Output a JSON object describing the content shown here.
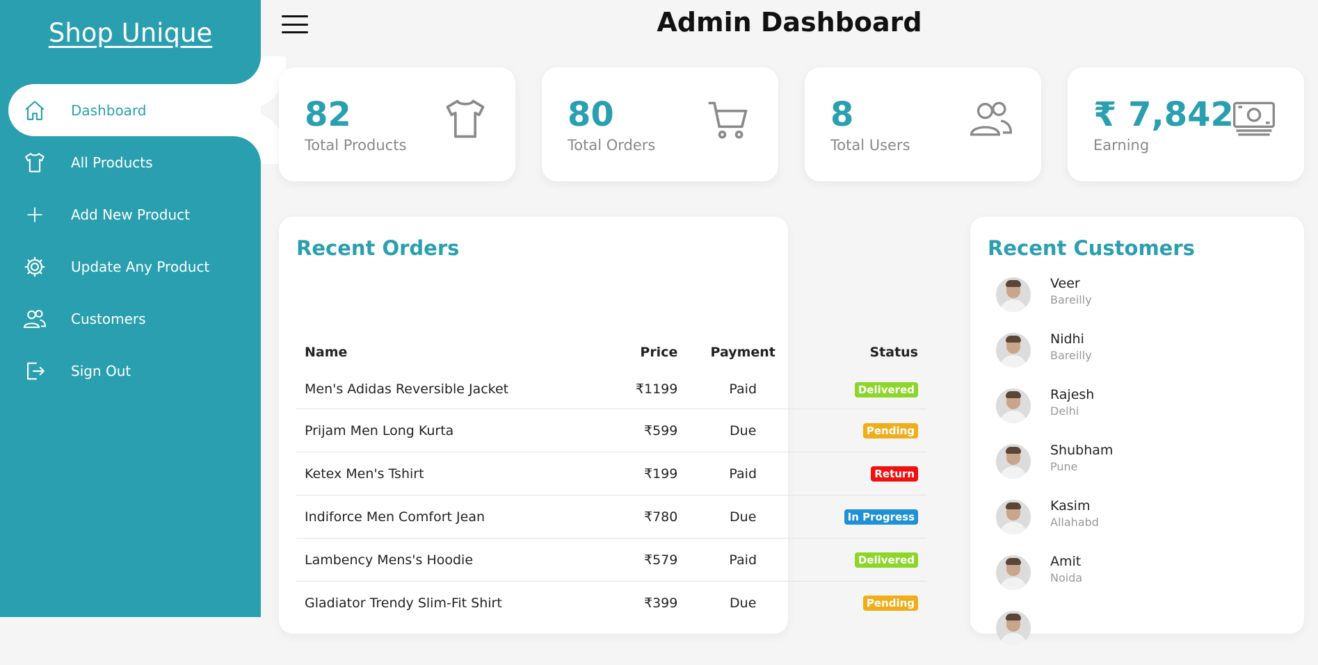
{
  "brand": "Shop Unique",
  "nav": [
    {
      "label": "Dashboard",
      "icon": "home-icon"
    },
    {
      "label": "All Products",
      "icon": "tshirt-icon"
    },
    {
      "label": "Add New Product",
      "icon": "plus-icon"
    },
    {
      "label": "Update Any Product",
      "icon": "gear-icon"
    },
    {
      "label": "Customers",
      "icon": "users-icon"
    },
    {
      "label": "Sign Out",
      "icon": "sign-out-icon"
    }
  ],
  "header": {
    "title": "Admin Dashboard"
  },
  "stats": [
    {
      "value": "82",
      "label": "Total Products",
      "icon": "tshirt-icon"
    },
    {
      "value": "80",
      "label": "Total Orders",
      "icon": "cart-icon"
    },
    {
      "value": "8",
      "label": "Total Users",
      "icon": "users-icon"
    },
    {
      "value": "₹ 7,842",
      "label": "Earning",
      "icon": "money-icon"
    }
  ],
  "orders": {
    "title": "Recent Orders",
    "columns": [
      "Name",
      "Price",
      "Payment",
      "Status"
    ],
    "rows": [
      {
        "name": "Men's Adidas Reversible Jacket",
        "price": "₹1199",
        "payment": "Paid",
        "status": "Delivered"
      },
      {
        "name": "Prijam Men Long Kurta",
        "price": "₹599",
        "payment": "Due",
        "status": "Pending"
      },
      {
        "name": "Ketex Men's Tshirt",
        "price": "₹199",
        "payment": "Paid",
        "status": "Return"
      },
      {
        "name": "Indiforce Men Comfort Jean",
        "price": "₹780",
        "payment": "Due",
        "status": "In Progress"
      },
      {
        "name": "Lambency Mens's Hoodie",
        "price": "₹579",
        "payment": "Paid",
        "status": "Delivered"
      },
      {
        "name": "Gladiator Trendy Slim-Fit Shirt",
        "price": "₹399",
        "payment": "Due",
        "status": "Pending"
      }
    ]
  },
  "status_colors": {
    "Delivered": "#8cd62a",
    "Pending": "#f0ad1a",
    "Return": "#f01010",
    "In Progress": "#1e90d6"
  },
  "customers": {
    "title": "Recent Customers",
    "list": [
      {
        "name": "Veer",
        "city": "Bareilly"
      },
      {
        "name": "Nidhi",
        "city": "Bareilly"
      },
      {
        "name": "Rajesh",
        "city": "Delhi"
      },
      {
        "name": "Shubham",
        "city": "Pune"
      },
      {
        "name": "Kasim",
        "city": "Allahabd"
      },
      {
        "name": "Amit",
        "city": "Noida"
      }
    ]
  },
  "colors": {
    "accent": "#2a9fb0",
    "background": "#f5f5f5"
  }
}
